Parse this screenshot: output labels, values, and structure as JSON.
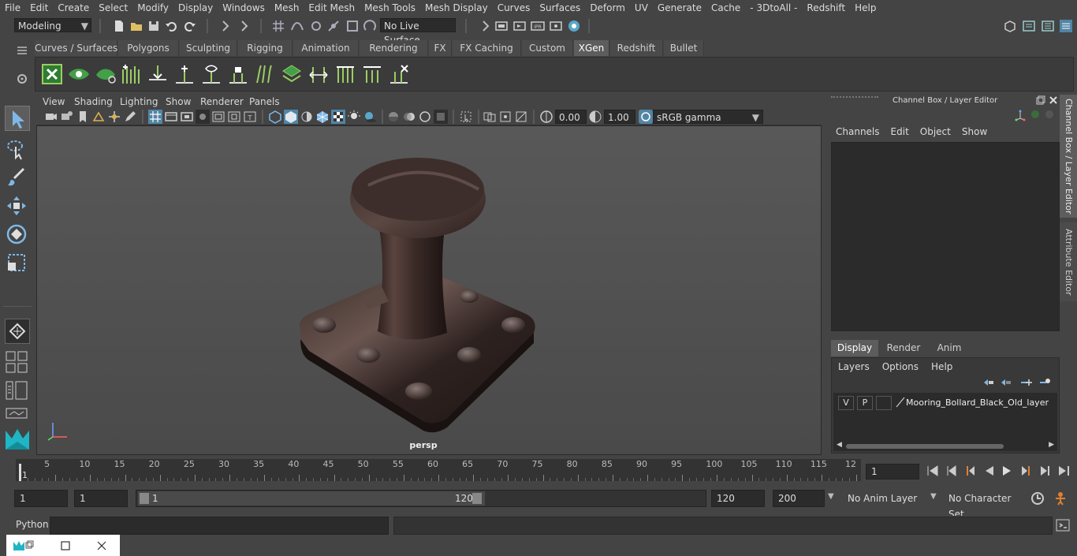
{
  "menubar": [
    "File",
    "Edit",
    "Create",
    "Select",
    "Modify",
    "Display",
    "Windows",
    "Mesh",
    "Edit Mesh",
    "Mesh Tools",
    "Mesh Display",
    "Curves",
    "Surfaces",
    "Deform",
    "UV",
    "Generate",
    "Cache",
    "- 3DtoAll -",
    "Redshift",
    "Help"
  ],
  "statusline": {
    "mode": "Modeling",
    "live_surface": "No Live Surface"
  },
  "shelf_tabs": [
    "Curves / Surfaces",
    "Polygons",
    "Sculpting",
    "Rigging",
    "Animation",
    "Rendering",
    "FX",
    "FX Caching",
    "Custom",
    "XGen",
    "Redshift",
    "Bullet"
  ],
  "shelf_active": "XGen",
  "viewport": {
    "menu": [
      "View",
      "Shading",
      "Lighting",
      "Show",
      "Renderer",
      "Panels"
    ],
    "exposure": "0.00",
    "gamma": "1.00",
    "colorspace": "sRGB gamma",
    "camera_label": "persp"
  },
  "channel_box": {
    "title": "Channel Box / Layer Editor",
    "menu": [
      "Channels",
      "Edit",
      "Object",
      "Show"
    ],
    "side_tabs": [
      "Channel Box / Layer Editor",
      "Attribute Editor"
    ]
  },
  "layer_editor": {
    "tabs": [
      "Display",
      "Render",
      "Anim"
    ],
    "active_tab": "Display",
    "menu": [
      "Layers",
      "Options",
      "Help"
    ],
    "layers": [
      {
        "v": "V",
        "p": "P",
        "name": "Mooring_Bollard_Black_Old_layer"
      }
    ]
  },
  "timeline": {
    "ticks": [
      "1",
      "5",
      "10",
      "15",
      "20",
      "25",
      "30",
      "35",
      "40",
      "45",
      "50",
      "55",
      "60",
      "65",
      "70",
      "75",
      "80",
      "85",
      "90",
      "95",
      "100",
      "105",
      "110",
      "115",
      "12"
    ],
    "current_frame": "1"
  },
  "range": {
    "start": "1",
    "anim_start": "1",
    "slider_start": "1",
    "slider_end": "120",
    "end": "120",
    "anim_end": "200",
    "anim_layer": "No Anim Layer",
    "character_set": "No Character Set"
  },
  "command_line": {
    "label": "Python"
  },
  "colors": {
    "accent": "#5285a6",
    "active_tab": "#5d5d5d",
    "select_highlight": "#5285a6"
  }
}
